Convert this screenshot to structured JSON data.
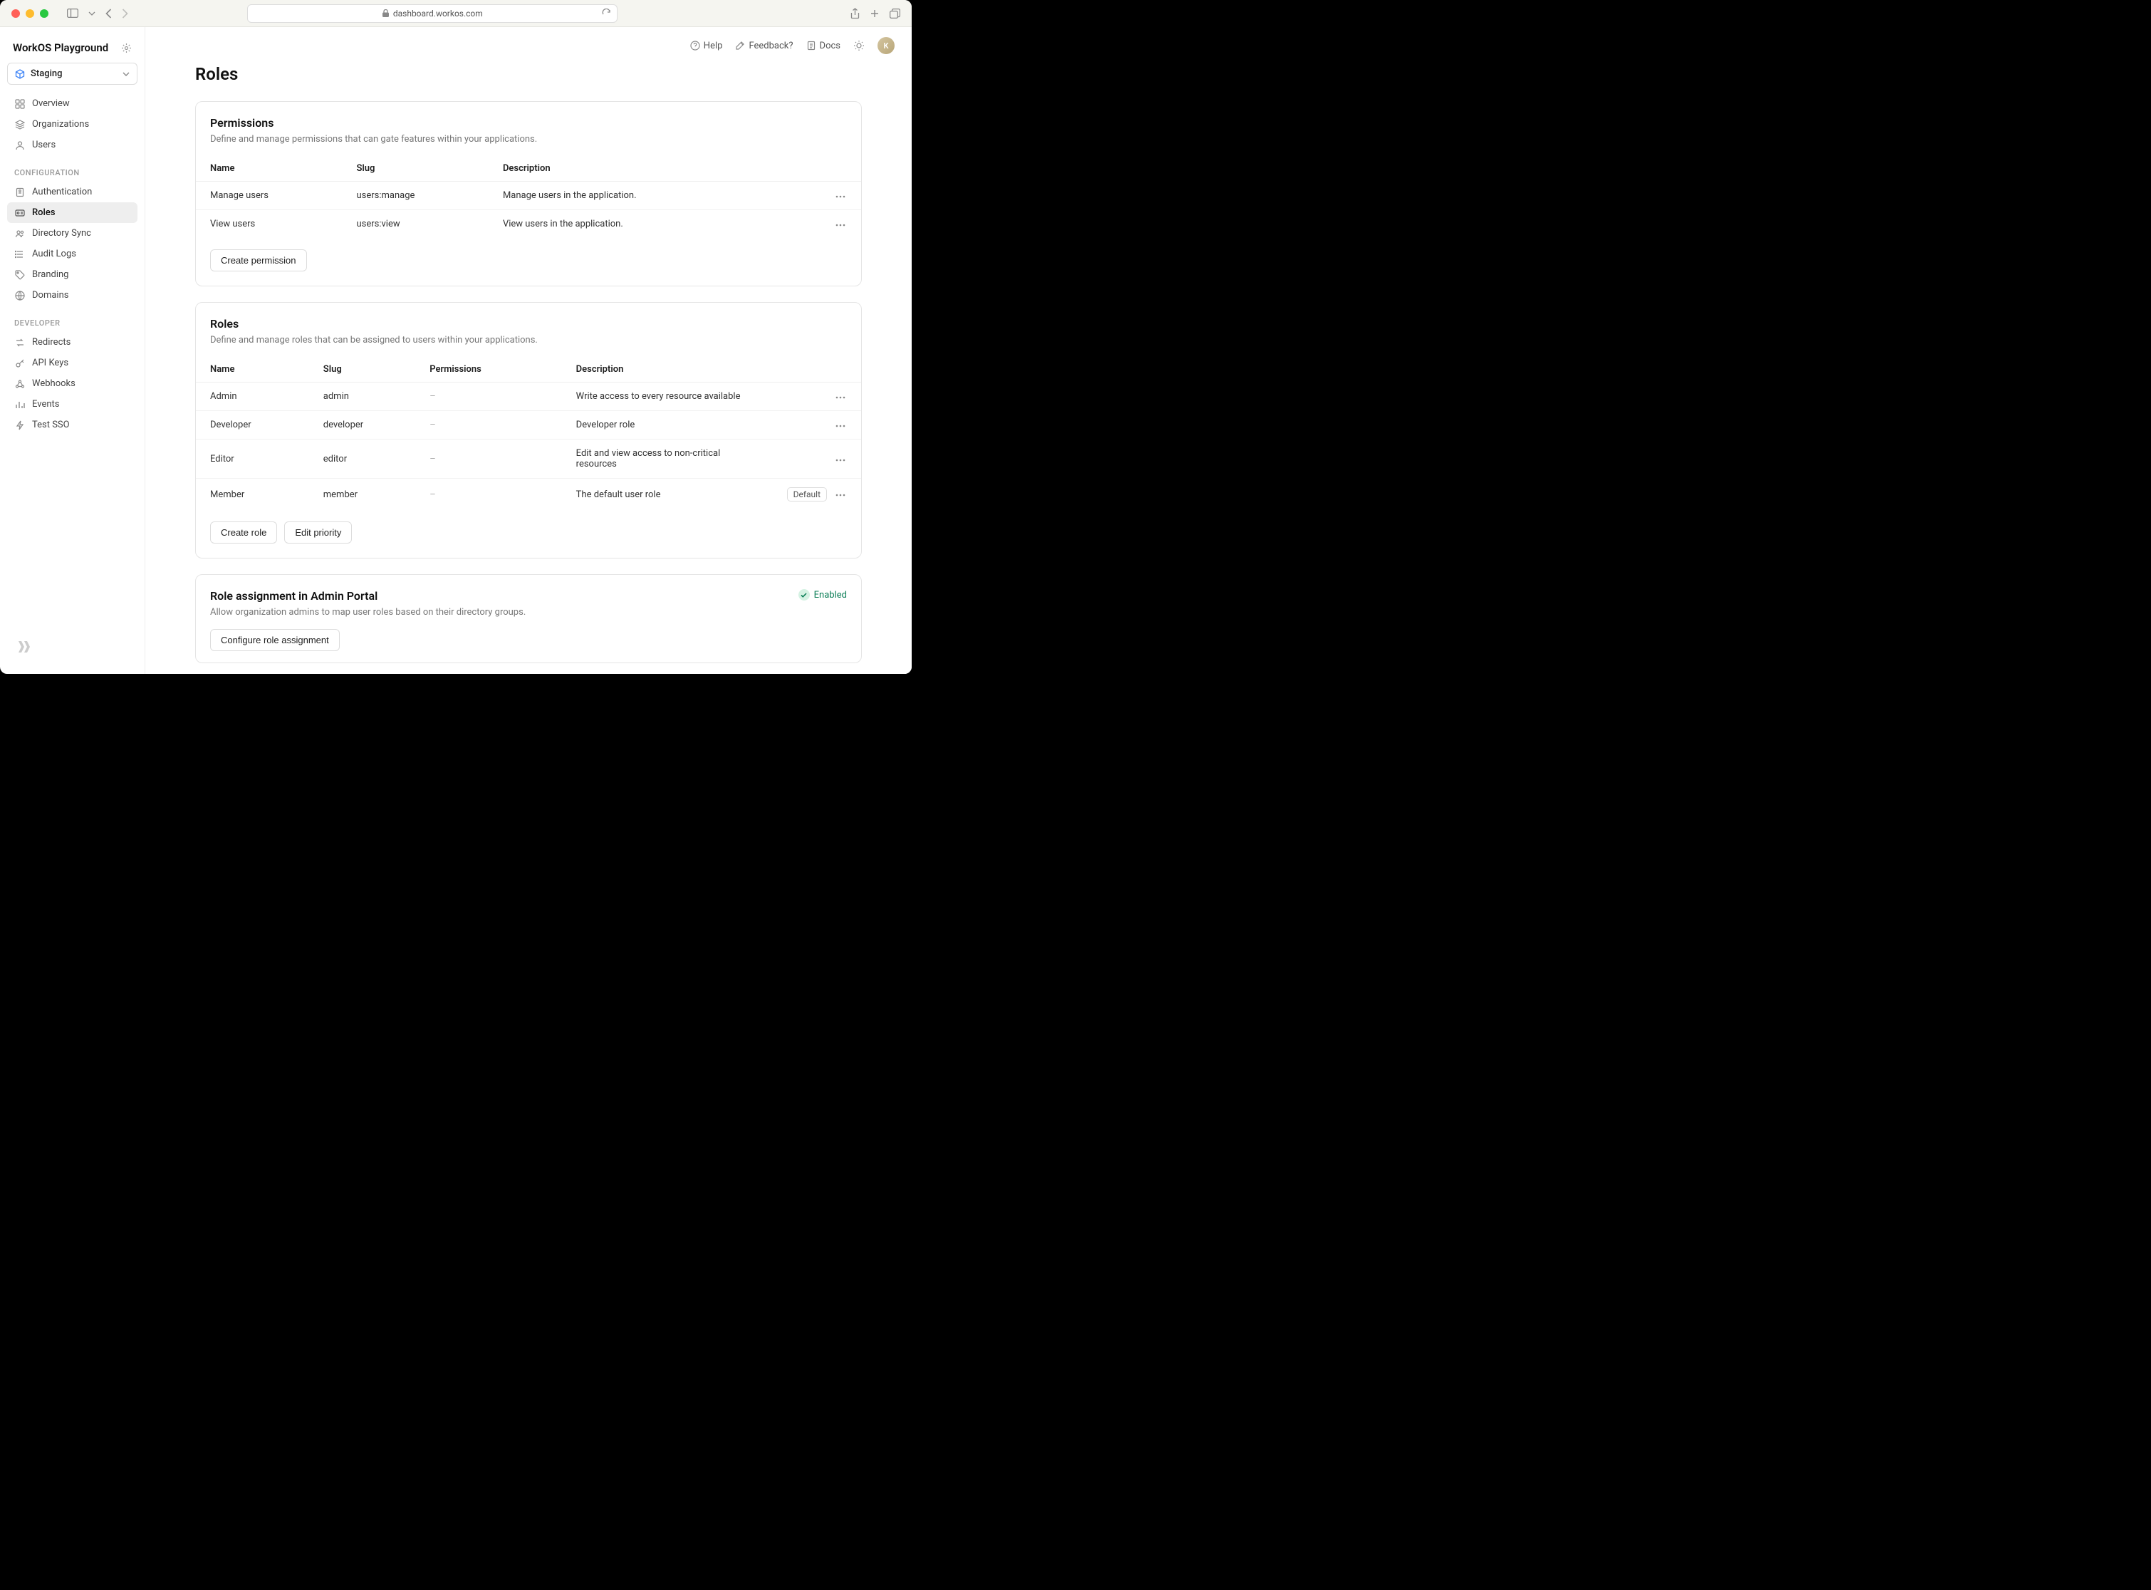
{
  "browser": {
    "url": "dashboard.workos.com"
  },
  "sidebar": {
    "workspace": "WorkOS Playground",
    "env": "Staging",
    "nav_main": [
      {
        "label": "Overview",
        "icon": "grid"
      },
      {
        "label": "Organizations",
        "icon": "layers"
      },
      {
        "label": "Users",
        "icon": "user"
      }
    ],
    "section_config": "CONFIGURATION",
    "nav_config": [
      {
        "label": "Authentication",
        "icon": "shield"
      },
      {
        "label": "Roles",
        "icon": "id",
        "active": true
      },
      {
        "label": "Directory Sync",
        "icon": "people"
      },
      {
        "label": "Audit Logs",
        "icon": "lines"
      },
      {
        "label": "Branding",
        "icon": "tag"
      },
      {
        "label": "Domains",
        "icon": "globe"
      }
    ],
    "section_dev": "DEVELOPER",
    "nav_dev": [
      {
        "label": "Redirects",
        "icon": "arrows"
      },
      {
        "label": "API Keys",
        "icon": "key"
      },
      {
        "label": "Webhooks",
        "icon": "hook"
      },
      {
        "label": "Events",
        "icon": "bars"
      },
      {
        "label": "Test SSO",
        "icon": "bolt"
      }
    ]
  },
  "topnav": {
    "help": "Help",
    "feedback": "Feedback?",
    "docs": "Docs",
    "avatar_initial": "K"
  },
  "page": {
    "title": "Roles"
  },
  "permissions_card": {
    "title": "Permissions",
    "desc": "Define and manage permissions that can gate features within your applications.",
    "headers": {
      "name": "Name",
      "slug": "Slug",
      "desc": "Description"
    },
    "rows": [
      {
        "name": "Manage users",
        "slug": "users:manage",
        "desc": "Manage users in the application."
      },
      {
        "name": "View users",
        "slug": "users:view",
        "desc": "View users in the application."
      }
    ],
    "create": "Create permission"
  },
  "roles_card": {
    "title": "Roles",
    "desc": "Define and manage roles that can be assigned to users within your applications.",
    "headers": {
      "name": "Name",
      "slug": "Slug",
      "perms": "Permissions",
      "desc": "Description"
    },
    "rows": [
      {
        "name": "Admin",
        "slug": "admin",
        "perms": "–",
        "desc": "Write access to every resource available"
      },
      {
        "name": "Developer",
        "slug": "developer",
        "perms": "–",
        "desc": "Developer role"
      },
      {
        "name": "Editor",
        "slug": "editor",
        "perms": "–",
        "desc": "Edit and view access to non-critical resources"
      },
      {
        "name": "Member",
        "slug": "member",
        "perms": "–",
        "desc": "The default user role",
        "default": true
      }
    ],
    "default_badge": "Default",
    "create": "Create role",
    "edit_priority": "Edit priority"
  },
  "assignment_card": {
    "title": "Role assignment in Admin Portal",
    "desc": "Allow organization admins to map user roles based on their directory groups.",
    "status": "Enabled",
    "configure": "Configure role assignment"
  }
}
